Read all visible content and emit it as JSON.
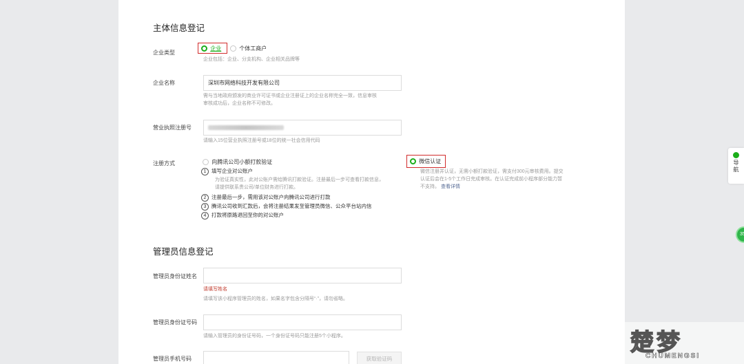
{
  "entity_section": {
    "title": "主体信息登记",
    "company_type": {
      "label": "企业类型",
      "option_company": "企业",
      "option_individual": "个体工商户",
      "hint": "企业包括：企业、分支机构、企业相关品牌等"
    },
    "company_name": {
      "label": "企业名称",
      "value": "深圳市网络科技开发有限公司",
      "hint_line1": "需与当地政府颁发的商业许可证书或企业注册证上的企业名称完全一致，信息审核",
      "hint_line2": "审核成功后，企业名称不可修改。"
    },
    "license": {
      "label": "营业执照注册号",
      "hint": "请输入15位营业执照注册号或18位的统一社会信用代码"
    },
    "register_method": {
      "label": "注册方式",
      "option_transfer": "向腾讯公司小额打款验证",
      "steps": [
        {
          "num": "1",
          "title": "填写企业对公账户",
          "desc1": "为验证真实性，此对公账户需给腾讯打款验证。注册最后一步可查看打款信息，",
          "desc2": "请提供联系贵公司/单位财务进行打款。"
        },
        {
          "num": "2",
          "title": "注册最后一步，需用该对公账户向腾讯公司进行打款"
        },
        {
          "num": "3",
          "title": "腾讯公司收到汇款后，会将注册结果发至管理员微信、公众平台站内信"
        },
        {
          "num": "4",
          "title": "打款将原路退回至你的对公账户"
        }
      ],
      "option_wechat": "微信认证",
      "wechat_desc1": "微信注册并认证，无需小额打款验证，需支付300元审核费用。提交",
      "wechat_desc2": "认证后会在1-5个工作日完成审核。在认证完成前小程序部分能力暂",
      "wechat_desc3": "不支持。",
      "wechat_link": "查看详情"
    }
  },
  "admin_section": {
    "title": "管理员信息登记",
    "id_name": {
      "label": "管理员身份证姓名",
      "error": "请填写姓名",
      "hint": "请填写该小程序管理员的姓名，如果名字包含分隔号“·”，请勿省略。"
    },
    "id_number": {
      "label": "管理员身份证号码",
      "hint": "请输入管理员的身份证号码，一个身份证号码只能注册5个小程序。"
    },
    "phone": {
      "label": "管理员手机号码",
      "button": "获取验证码"
    }
  },
  "side": {
    "guide_label_1": "导",
    "guide_label_2": "航",
    "float_badge": "35"
  },
  "watermark": {
    "main": "楚梦",
    "sub": "CHUMENGSI"
  },
  "colors": {
    "accent_green": "#1aad19",
    "highlight_red": "#d12a2a",
    "error_red": "#c0392b"
  }
}
